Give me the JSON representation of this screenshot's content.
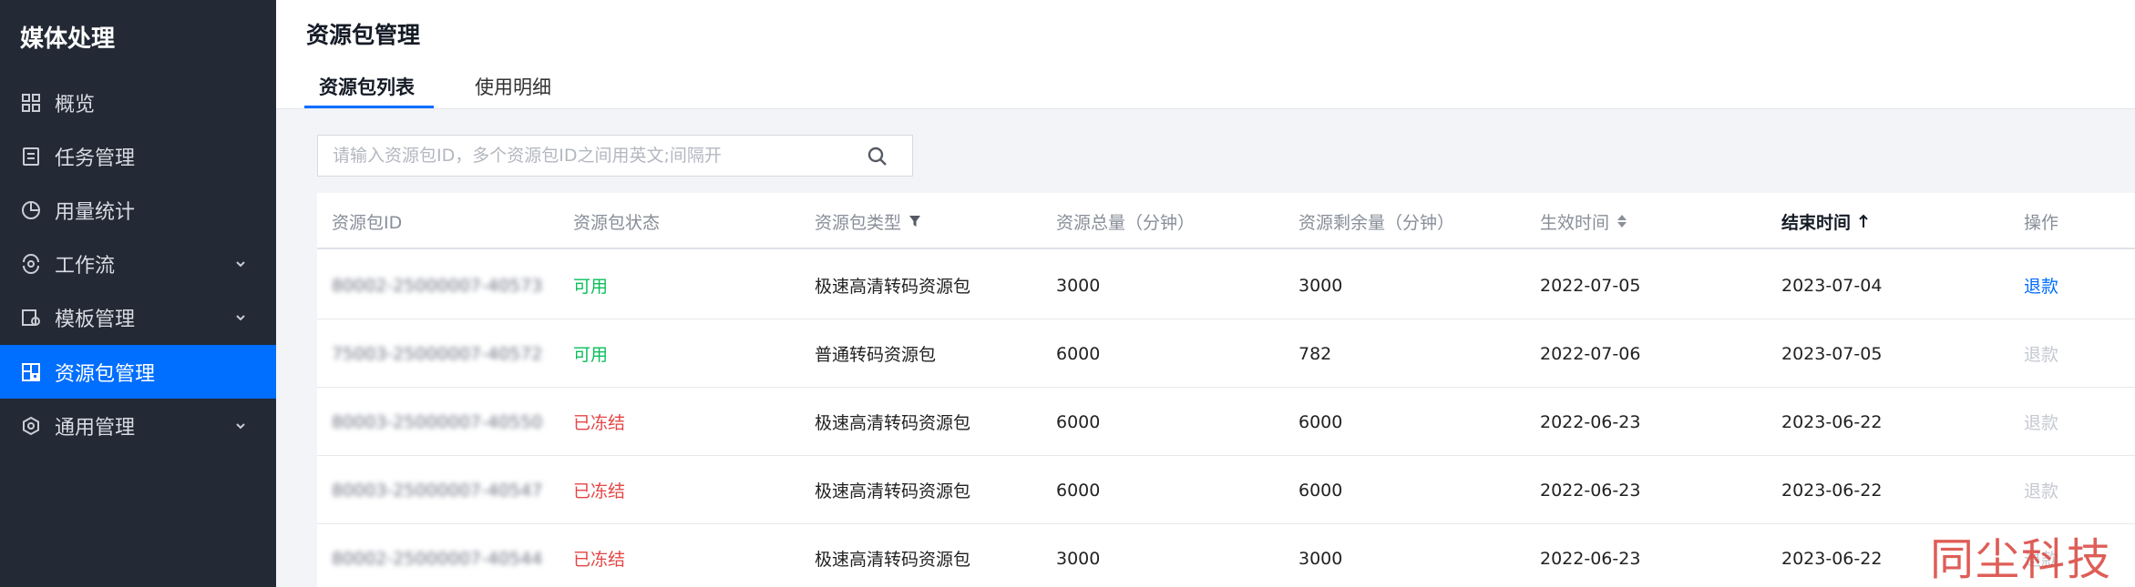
{
  "sidebar": {
    "title": "媒体处理",
    "items": [
      {
        "label": "概览",
        "icon": "dashboard-icon",
        "expandable": false,
        "active": false
      },
      {
        "label": "任务管理",
        "icon": "document-icon",
        "expandable": false,
        "active": false
      },
      {
        "label": "用量统计",
        "icon": "pie-chart-icon",
        "expandable": false,
        "active": false
      },
      {
        "label": "工作流",
        "icon": "workflow-icon",
        "expandable": true,
        "active": false
      },
      {
        "label": "模板管理",
        "icon": "template-icon",
        "expandable": true,
        "active": false
      },
      {
        "label": "资源包管理",
        "icon": "package-icon",
        "expandable": false,
        "active": true
      },
      {
        "label": "通用管理",
        "icon": "settings-icon",
        "expandable": true,
        "active": false
      }
    ]
  },
  "header": {
    "title": "资源包管理",
    "tabs": [
      {
        "label": "资源包列表",
        "active": true
      },
      {
        "label": "使用明细",
        "active": false
      }
    ]
  },
  "search": {
    "placeholder": "请输入资源包ID，多个资源包ID之间用英文;间隔开",
    "value": ""
  },
  "table": {
    "columns": [
      {
        "label": "资源包ID"
      },
      {
        "label": "资源包状态"
      },
      {
        "label": "资源包类型"
      },
      {
        "label": "资源总量（分钟）"
      },
      {
        "label": "资源剩余量（分钟）"
      },
      {
        "label": "生效时间"
      },
      {
        "label": "结束时间"
      },
      {
        "label": "操作"
      }
    ],
    "rows": [
      {
        "id": "80002-25000007-40573",
        "status": "可用",
        "status_type": "ok",
        "type": "极速高清转码资源包",
        "total": "3000",
        "remaining": "3000",
        "start": "2022-07-05",
        "end": "2023-07-04",
        "action": "退款",
        "action_enabled": true
      },
      {
        "id": "75003-25000007-40572",
        "status": "可用",
        "status_type": "ok",
        "type": "普通转码资源包",
        "total": "6000",
        "remaining": "782",
        "start": "2022-07-06",
        "end": "2023-07-05",
        "action": "退款",
        "action_enabled": false
      },
      {
        "id": "80003-25000007-40550",
        "status": "已冻结",
        "status_type": "frozen",
        "type": "极速高清转码资源包",
        "total": "6000",
        "remaining": "6000",
        "start": "2022-06-23",
        "end": "2023-06-22",
        "action": "退款",
        "action_enabled": false
      },
      {
        "id": "80003-25000007-40547",
        "status": "已冻结",
        "status_type": "frozen",
        "type": "极速高清转码资源包",
        "total": "6000",
        "remaining": "6000",
        "start": "2022-06-23",
        "end": "2023-06-22",
        "action": "退款",
        "action_enabled": false
      },
      {
        "id": "80002-25000007-40544",
        "status": "已冻结",
        "status_type": "frozen",
        "type": "极速高清转码资源包",
        "total": "3000",
        "remaining": "3000",
        "start": "2022-06-23",
        "end": "2023-06-22",
        "action": "退款",
        "action_enabled": false
      }
    ]
  },
  "watermark": "同尘科技",
  "colors": {
    "accent": "#006eff",
    "ok": "#0abf5b",
    "frozen": "#e54545",
    "sidebar_bg": "#232935"
  }
}
